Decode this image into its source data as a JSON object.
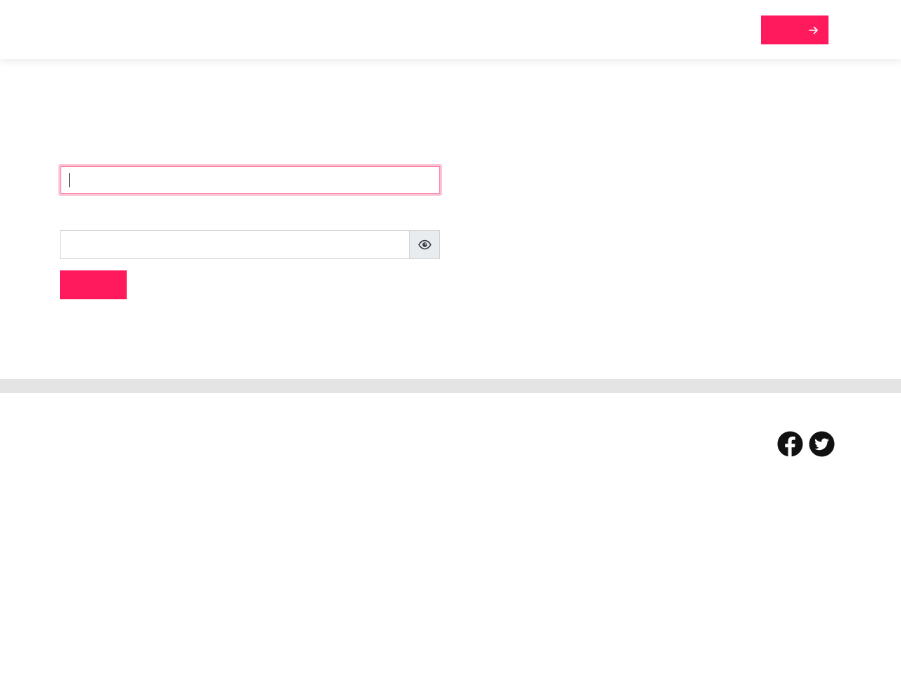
{
  "header": {
    "cta_label": "",
    "cta_icon": "arrow-right-icon"
  },
  "login_form": {
    "email_value": "",
    "email_placeholder": "",
    "password_value": "",
    "password_placeholder": "",
    "toggle_icon": "eye-icon",
    "submit_label": ""
  },
  "footer": {
    "social": [
      {
        "icon": "facebook-icon",
        "label": "Facebook"
      },
      {
        "icon": "twitter-icon",
        "label": "Twitter"
      }
    ]
  },
  "colors": {
    "accent": "#ff1a5e",
    "focus_ring": "#f8c4d3",
    "band": "#e4e4e4",
    "addon_bg": "#e9ecef",
    "icon_dark": "#111111"
  }
}
